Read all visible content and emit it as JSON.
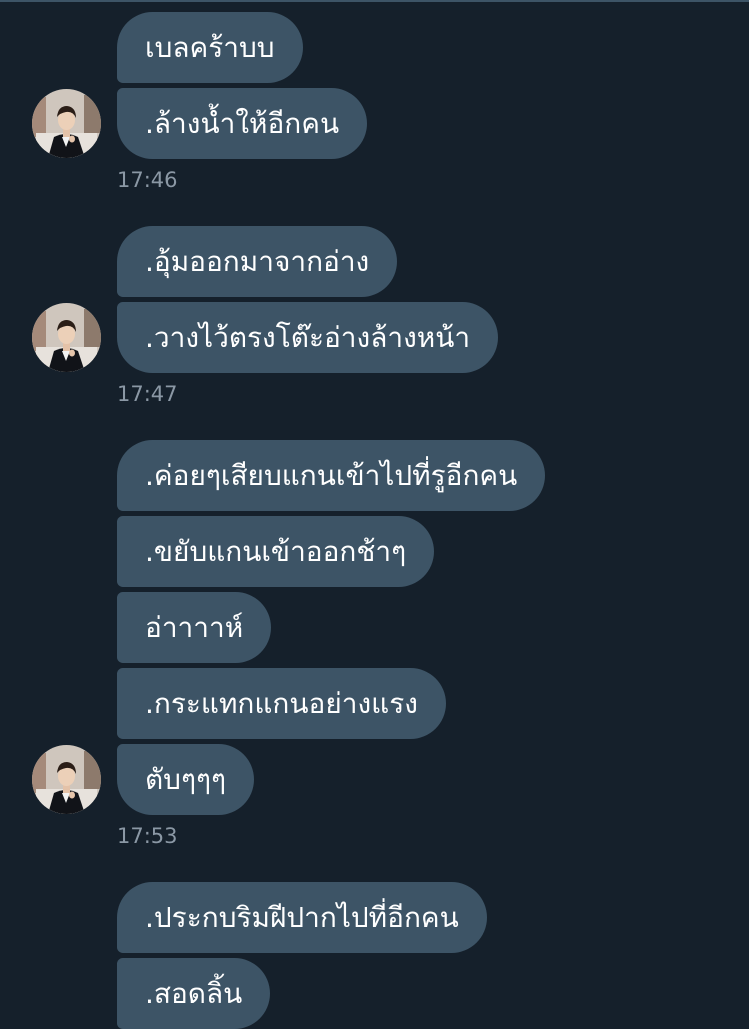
{
  "colors": {
    "background": "#15202b",
    "bubble": "#3d5466",
    "bubble_text": "#ffffff",
    "timestamp": "#8b98a5"
  },
  "conversation": {
    "groups": [
      {
        "messages": [
          "เบลคร้าบบ",
          ".ล้างน้ำให้อีกคน"
        ],
        "time": "17:46",
        "avatar": "profile-photo"
      },
      {
        "messages": [
          ".อุ้มออกมาจากอ่าง",
          ".วางไว้ตรงโต๊ะอ่างล้างหน้า"
        ],
        "time": "17:47",
        "avatar": "profile-photo"
      },
      {
        "messages": [
          ".ค่อยๆเสียบแกนเข้าไปที่รูอีกคน",
          ".ขยับแกนเข้าออกช้าๆ",
          "อ่าาาาห์",
          ".กระแทกแกนอย่างแรง",
          "ตับๆๆๆ"
        ],
        "time": "17:53",
        "avatar": "profile-photo"
      },
      {
        "messages": [
          ".ประกบริมฝีปากไปที่อีกคน",
          ".สอดลิ้น"
        ]
      }
    ]
  }
}
